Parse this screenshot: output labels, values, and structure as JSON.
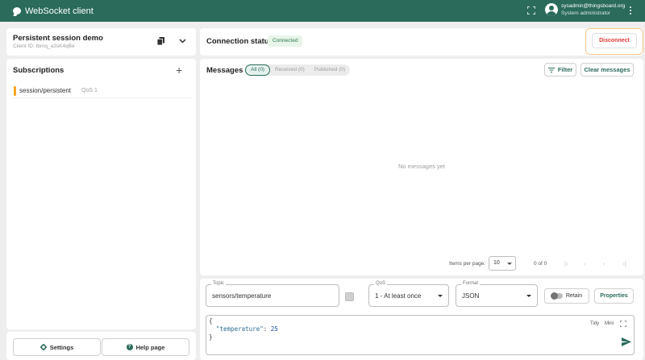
{
  "app": {
    "title": "WebSocket client",
    "user_email": "sysadmin@thingsboard.org",
    "user_role": "System administrator",
    "brand_color": "#2a6b5b"
  },
  "session": {
    "name": "Persistent session demo",
    "client_id": "Client ID: tbmq_a3sK4qBe"
  },
  "subscriptions": {
    "title": "Subscriptions",
    "items": [
      {
        "topic": "session/persistent",
        "qos": "QoS 1",
        "color": "#f5a623"
      }
    ]
  },
  "footer": {
    "settings_label": "Settings",
    "help_label": "Help page",
    "help_glyph": "?"
  },
  "connection": {
    "title": "Connection status",
    "status": "Connected",
    "disconnect_label": "Disconnect"
  },
  "messages": {
    "title": "Messages",
    "tabs": [
      {
        "label": "All (0)",
        "active": true
      },
      {
        "label": "Received (0)",
        "active": false
      },
      {
        "label": "Published (0)",
        "active": false
      }
    ],
    "filter_label": "Filter",
    "clear_label": "Clear messages",
    "empty_text": "No messages yet",
    "items_per_page_label": "Items per page:",
    "items_per_page": "10",
    "range": "0 of 0",
    "pager_glyphs": {
      "first": "|‹",
      "prev": "‹",
      "next": "›",
      "last": "›|"
    }
  },
  "publish": {
    "topic_label": "Topic",
    "topic_value": "sensors/temperature",
    "qos_label": "QoS",
    "qos_value": "1 - At least once",
    "format_label": "Format",
    "format_value": "JSON",
    "retain_label": "Retain",
    "properties_label": "Properties",
    "payload": {
      "open": "{",
      "key": "\"temperature\"",
      "sep": ": ",
      "value": "25",
      "close": "}"
    },
    "tidy_label": "Tidy",
    "mini_label": "Mini"
  }
}
